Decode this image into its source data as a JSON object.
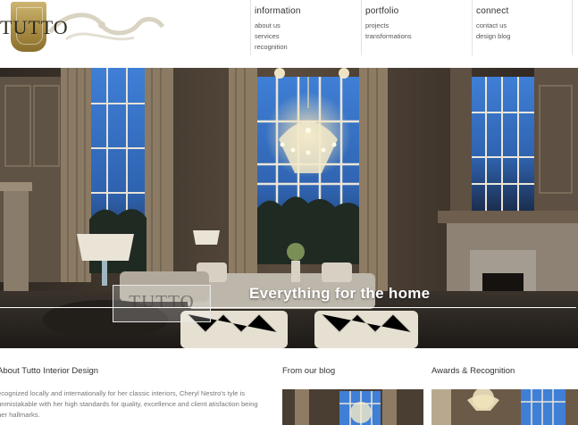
{
  "logo": {
    "text": "TUTTO"
  },
  "nav": {
    "information": {
      "title": "information",
      "links": [
        "about us",
        "services",
        "recognition"
      ]
    },
    "portfolio": {
      "title": "portfolio",
      "links": [
        "projects",
        "transformations"
      ]
    },
    "connect": {
      "title": "connect",
      "links": [
        "contact us",
        "design blog"
      ]
    }
  },
  "hero": {
    "tagline": "Everything for the home",
    "stamp_text": "TUTTO"
  },
  "sections": {
    "about": {
      "title": "About Tutto Interior Design",
      "text": "ecognized locally and internationally for her classic interiors, Cheryl Nestro's tyle is unmistakable with her high standards for quality, excellence and client atisfaction being her hallmarks."
    },
    "blog": {
      "title": "From our blog"
    },
    "awards": {
      "title": "Awards & Recognition"
    }
  },
  "colors": {
    "gold": "#b39a55",
    "background": "#ffffff",
    "text": "#333333"
  }
}
